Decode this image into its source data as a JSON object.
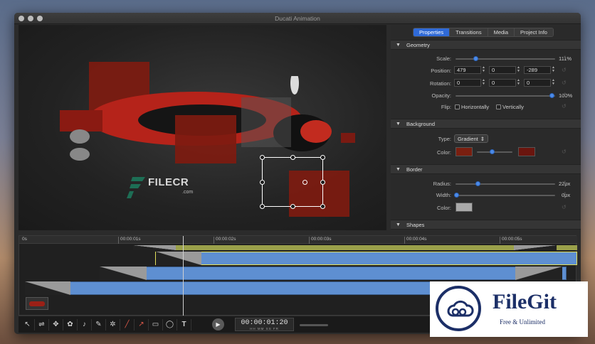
{
  "window": {
    "title": "Ducati Animation"
  },
  "watermark": {
    "text": "FILECR",
    "sub": ".com"
  },
  "inspector": {
    "tabs": [
      {
        "label": "Properties",
        "active": true
      },
      {
        "label": "Transitions",
        "active": false
      },
      {
        "label": "Media",
        "active": false
      },
      {
        "label": "Project Info",
        "active": false
      }
    ],
    "geometry": {
      "header": "Geometry",
      "scale_label": "Scale:",
      "scale_value": "111%",
      "position_label": "Position:",
      "position_x": "479",
      "position_y": "0",
      "position_z": "-289",
      "rotation_label": "Rotation:",
      "rotation_x": "0",
      "rotation_y": "0",
      "rotation_z": "0",
      "opacity_label": "Opacity:",
      "opacity_value": "100%",
      "flip_label": "Flip:",
      "flip_h": "Horizontally",
      "flip_v": "Vertically"
    },
    "background": {
      "header": "Background",
      "type_label": "Type:",
      "type_value": "Gradient",
      "color_label": "Color:",
      "color_start": "#7a1f10",
      "color_end": "#6a150e"
    },
    "border": {
      "header": "Border",
      "radius_label": "Radius:",
      "radius_value": "22px",
      "width_label": "Width:",
      "width_value": "0px",
      "color_label": "Color:",
      "color": "#a9a9a9"
    },
    "shapes": {
      "header": "Shapes"
    }
  },
  "timeline": {
    "ticks": [
      "0s",
      "00:00:01s",
      "00:00:02s",
      "00:00:03s",
      "00:00:04s",
      "00:00:05s"
    ]
  },
  "toolbar": {
    "tools": [
      "pointer-icon",
      "motion-path-icon",
      "move-icon",
      "particles-icon",
      "microphone-icon",
      "brush-icon",
      "snowflake-icon",
      "line-icon",
      "arrow-icon",
      "rectangle-icon",
      "ellipse-icon",
      "text-icon"
    ],
    "tool_glyphs": [
      "↖",
      "⇌",
      "✥",
      "✿",
      "♪",
      "✎",
      "✲",
      "╱",
      "↗",
      "▭",
      "◯",
      "T"
    ],
    "timecode": "00:00:01:20",
    "timecode_units": "HH  MM  SS  FR"
  },
  "filegit": {
    "name": "FileGit",
    "tagline": "Free & Unlimited"
  }
}
